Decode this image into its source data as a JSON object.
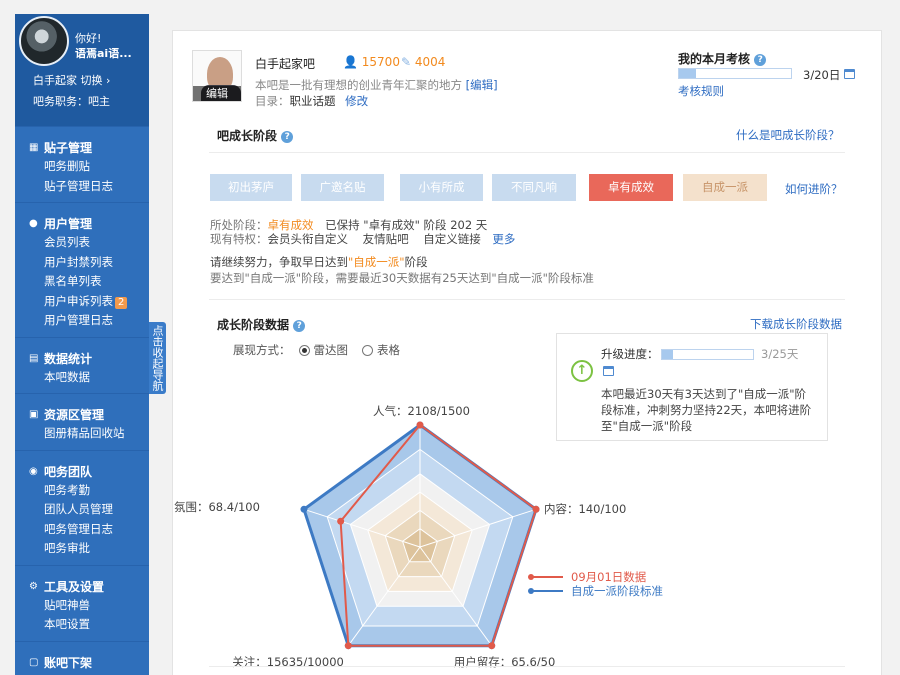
{
  "sidebar": {
    "greeting": "你好!",
    "username": "语焉ai语...",
    "forum_line": "白手起家  切换 ›",
    "role_line": "吧务职务：吧主",
    "collapse_label": "点击收起导航",
    "groups": [
      {
        "title": "贴子管理",
        "icon": "document-icon",
        "items": [
          "吧务删贴",
          "贴子管理日志"
        ]
      },
      {
        "title": "用户管理",
        "icon": "user-icon",
        "items": [
          "会员列表",
          "用户封禁列表",
          "黑名单列表",
          "用户申诉列表",
          "用户管理日志"
        ],
        "badge": "2"
      },
      {
        "title": "数据统计",
        "icon": "bar-chart-icon",
        "items": [
          "本吧数据"
        ]
      },
      {
        "title": "资源区管理",
        "icon": "folder-icon",
        "items": [
          "图册精品回收站"
        ]
      },
      {
        "title": "吧务团队",
        "icon": "team-icon",
        "items": [
          "吧务考勤",
          "团队人员管理",
          "吧务管理日志",
          "吧务审批"
        ]
      },
      {
        "title": "工具及设置",
        "icon": "gear-icon",
        "items": [
          "贴吧神兽",
          "本吧设置"
        ]
      },
      {
        "title": "账吧下架",
        "icon": "box-icon",
        "items": []
      }
    ]
  },
  "forum": {
    "name": "白手起家吧",
    "members": "15700",
    "posts": "4004",
    "description": "本吧是一批有理想的创业青年汇聚的地方",
    "edit_link": "[编辑]",
    "catalog_label": "目录：",
    "catalog_value": "职业话题",
    "catalog_edit": "修改",
    "avatar_edit": "编辑"
  },
  "assessment": {
    "title": "我的本月考核",
    "value": "3/20日",
    "rule_link": "考核规则",
    "progress": 0.15
  },
  "growth": {
    "title": "吧成长阶段",
    "help_link": "什么是吧成长阶段？",
    "stages": [
      "初出茅庐",
      "广邀名贴",
      "小有所成",
      "不同凡响",
      "卓有成效",
      "自成一派"
    ],
    "how_link": "如何进阶？",
    "current_label": "所处阶段：",
    "current_stage": "卓有成效",
    "kept_text": "已保持 \"卓有成效\" 阶段 202 天",
    "privilege_label": "现有特权：",
    "privileges": "会员头衔自定义    友情贴吧    自定义链接",
    "more_link": "更多",
    "encourage_pre": "请继续努力，争取早日达到",
    "encourage_target": "\"自成一派\"",
    "encourage_post": "阶段",
    "requirement": "要达到\"自成一派\"阶段，需要最近30天数据有25天达到\"自成一派\"阶段标准"
  },
  "stats": {
    "title": "成长阶段数据",
    "download_link": "下载成长阶段数据",
    "display_label": "展现方式：",
    "radar_option": "雷达图",
    "table_option": "表格",
    "upgrade_label": "升级进度：",
    "upgrade_value": "3/25天",
    "upgrade_progress": 0.12,
    "upgrade_text": "本吧最近30天有3天达到了\"自成一派\"阶段标准，冲刺努力坚持22天，本吧将进阶至\"自成一派\"阶段"
  },
  "chart_data": {
    "type": "radar",
    "axes": [
      "人气：2108/1500",
      "内容：140/100",
      "用户留存：65.6/50",
      "关注：15635/10000",
      "氛围：68.4/100"
    ],
    "series": [
      {
        "name": "09月01日数据",
        "values": [
          1.0,
          1.0,
          1.0,
          1.0,
          0.684
        ],
        "color": "#e15a4a"
      },
      {
        "name": "自成一派阶段标准",
        "values": [
          1.0,
          1.0,
          1.0,
          1.0,
          1.0
        ],
        "color": "#3d7ac4"
      }
    ],
    "range": [
      0,
      1
    ]
  }
}
